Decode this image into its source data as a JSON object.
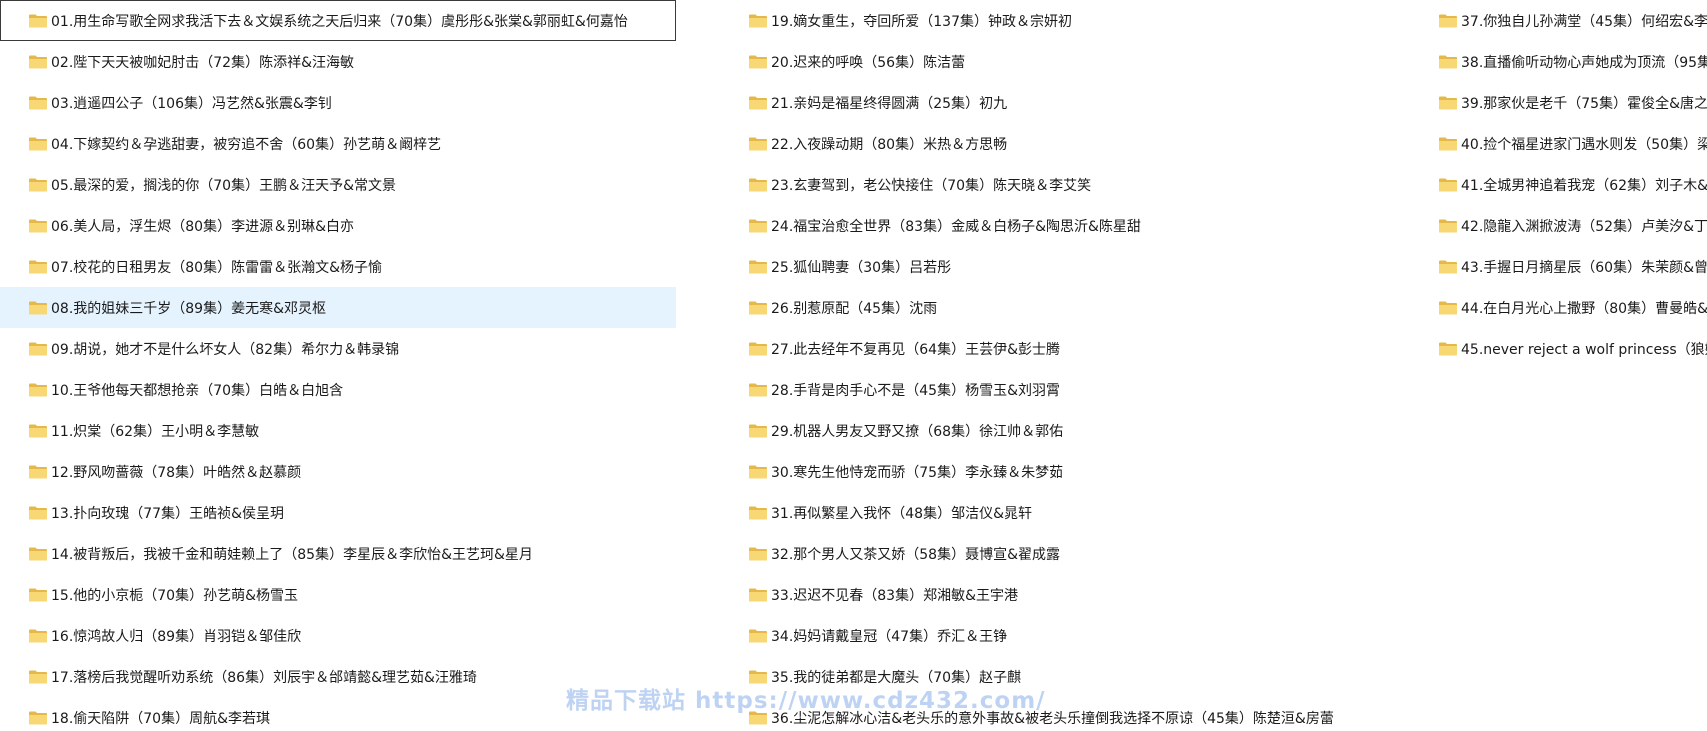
{
  "colors": {
    "folder": "#f8d775",
    "folder_dark": "#e4b94a",
    "selection": "#e5f3ff",
    "watermark": "#4682dc"
  },
  "icon": "folder-icon",
  "columns": [
    {
      "items": [
        "01.用生命写歌全网求我活下去＆文娱系统之天后归来（70集）虞彤彤&张棠&郭丽虹&何嘉怡",
        "02.陛下天天被咖妃肘击（72集）陈添祥&汪海敏",
        "03.逍遥四公子（106集）冯艺然&张震&李钊",
        "04.下嫁契约＆孕逃甜妻，被穷追不舍（60集）孙艺萌＆阚梓艺",
        "05.最深的爱，搁浅的你（70集）王鹏＆汪天予&常文景",
        "06.美人局，浮生烬（80集）李进源＆别琳&白亦",
        "07.校花的日租男友（80集）陈雷雷＆张瀚文&杨子愉",
        "08.我的姐妹三千岁（89集）姜无寒&邓灵枢",
        "09.胡说，她才不是什么坏女人（82集）希尔力＆韩录锦",
        "10.王爷他每天都想抢亲（70集）白皓＆白旭含",
        "11.炽棠（62集）王小明＆李慧敏",
        "12.野风吻蔷薇（78集）叶皓然＆赵慕颜",
        "13.扑向玫瑰（77集）王皓祯&侯呈玥",
        "14.被背叛后，我被千金和萌娃赖上了（85集）李星辰＆李欣怡&王艺珂&星月",
        "15.他的小京栀（70集）孙艺萌&杨雪玉",
        "16.惊鸿故人归（89集）肖羽铠＆邹佳欣",
        "17.落榜后我觉醒听劝系统（86集）刘辰宇＆邰靖懿&理艺茹&汪雅琦",
        "18.偷天陷阱（70集）周航&李若琪"
      ]
    },
    {
      "items": [
        "19.嫡女重生，夺回所爱（137集）钟政＆宗妍初",
        "20.迟来的呼唤（56集）陈洁蕾",
        "21.亲妈是福星终得圆满（25集）初九",
        "22.入夜躁动期（80集）米热＆方思畅",
        "23.玄妻驾到，老公快接住（70集）陈天晓＆李艾笑",
        "24.福宝治愈全世界（83集）金威＆白杨子&陶思沂&陈星甜",
        "25.狐仙聘妻（30集）吕若彤",
        "26.别惹原配（45集）沈雨",
        "27.此去经年不复再见（64集）王芸伊&彭士腾",
        "28.手背是肉手心不是（45集）杨雪玉&刘羽霄",
        "29.机器人男友又野又撩（68集）徐江帅＆郭佑",
        "30.寒先生他恃宠而骄（75集）李永臻＆朱梦茹",
        "31.再似繁星入我怀（48集）邹洁仪&晁轩",
        "32.那个男人又茶又娇（58集）聂博宣&翟成露",
        "33.迟迟不见春（83集）郑湘敏&王宇港",
        "34.妈妈请戴皇冠（47集）乔汇＆王铮",
        "35.我的徒弟都是大魔头（70集）赵子麒",
        "36.尘泥怎解冰心洁&老头乐的意外事故&被老头乐撞倒我选择不原谅（45集）陈楚洹&房蕾"
      ]
    },
    {
      "items": [
        "37.你独自儿孙满堂（45集）何绍宏&李",
        "38.直播偷听动物心声她成为顶流（95集",
        "39.那家伙是老千（75集）霍俊全&唐之",
        "40.捡个福星进家门遇水则发（50集）梁",
        "41.全城男神追着我宠（62集）刘子木&",
        "42.隐龍入渊掀波涛（52集）卢美汐&丁",
        "43.手握日月摘星辰（60集）朱茉颜&曾",
        "44.在白月光心上撒野（80集）曹曼皓&",
        "45.never reject a wolf princess（狼姬"
      ]
    }
  ],
  "watermark": "精品下载站 https://www.cdz432.com/"
}
